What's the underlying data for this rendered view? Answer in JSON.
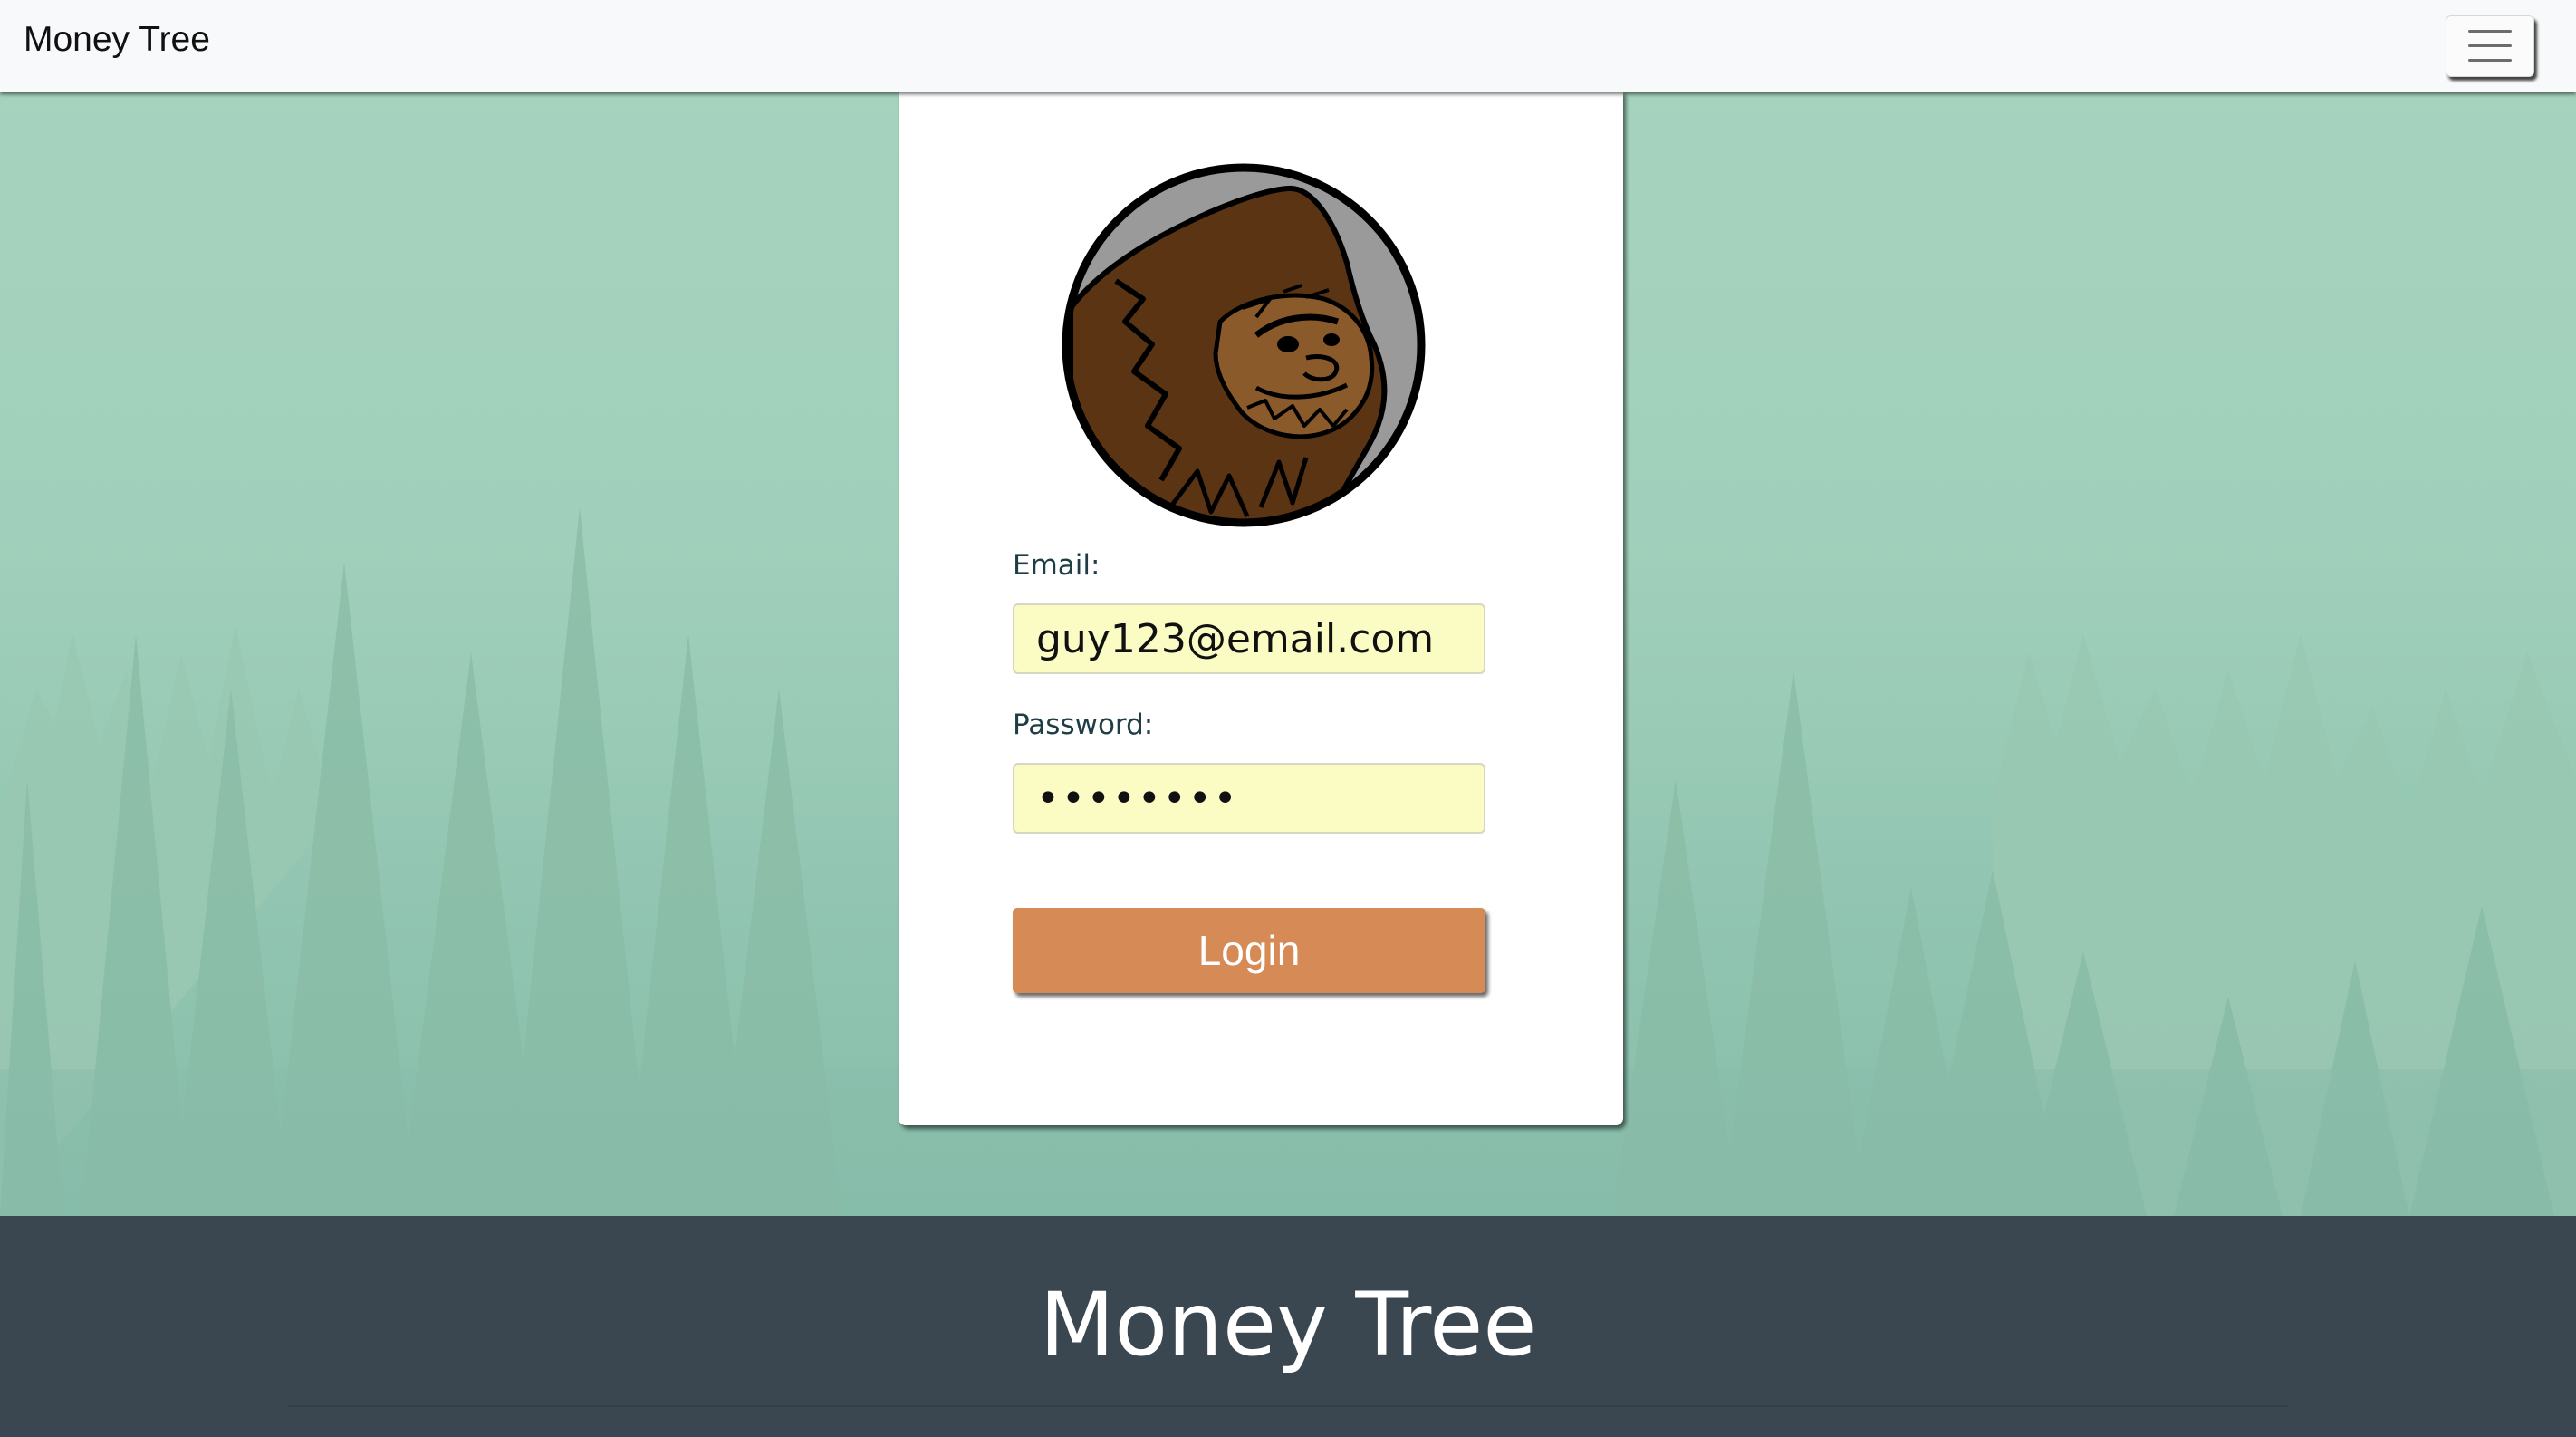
{
  "navbar": {
    "brand": "Money Tree",
    "menu_icon": "hamburger-menu-icon"
  },
  "login": {
    "avatar": "bigfoot-logo",
    "email_label": "Email:",
    "email_value": "guy123@email.com",
    "password_label": "Password:",
    "password_value": "••••••••",
    "login_label": "Login"
  },
  "footer": {
    "title": "Money Tree"
  },
  "colors": {
    "navbar_bg": "#f8f9fa",
    "background_teal": "#a6d2bd",
    "input_bg": "#fafcc4",
    "button_bg": "#d68a55",
    "footer_bg": "#3b4750"
  }
}
